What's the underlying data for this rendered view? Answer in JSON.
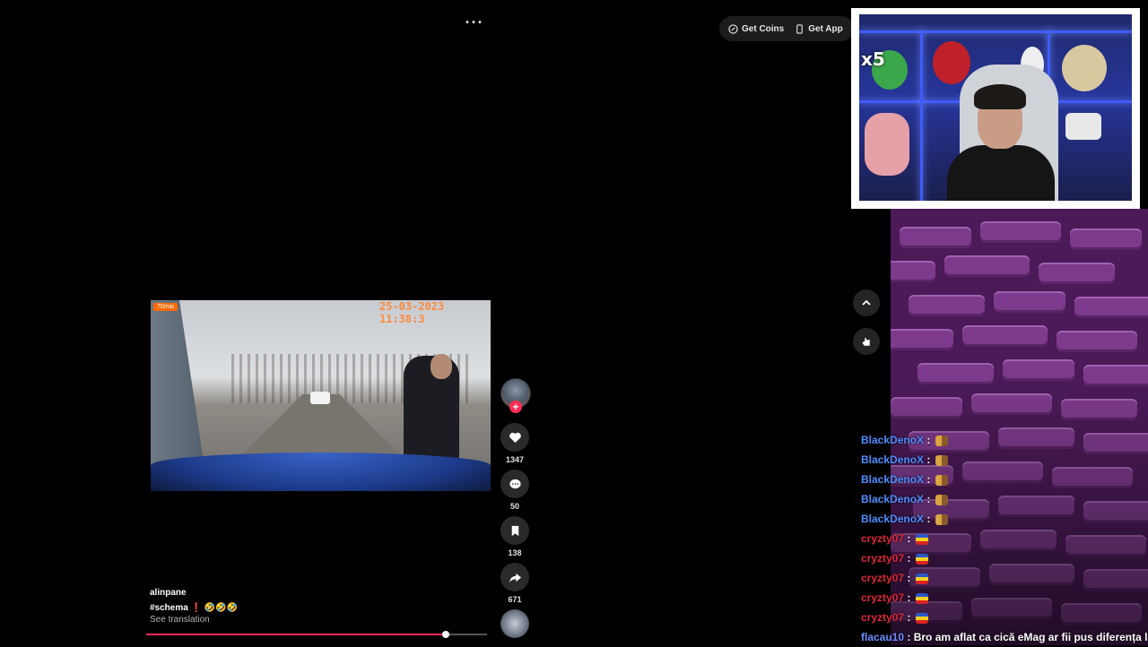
{
  "topbar": {
    "more_label": "···",
    "get_coins": "Get Coins",
    "get_app": "Get App"
  },
  "webcam": {
    "badge": "x5"
  },
  "video": {
    "brand": "70mai",
    "timestamp": "25-03-2023 11:38:3",
    "progress_fraction": 0.88
  },
  "actions": {
    "likes": "1347",
    "comments": "50",
    "saves": "138",
    "shares": "671"
  },
  "post": {
    "username": "alinpane",
    "caption": "#schema ❗ 🤣🤣🤣",
    "see_translation": "See translation"
  },
  "chat": [
    {
      "user": "BlackDenoX",
      "sep": " : ",
      "msg": "",
      "user_color": "#4f8cff",
      "emote": "cat-emote"
    },
    {
      "user": "BlackDenoX",
      "sep": " : ",
      "msg": "",
      "user_color": "#4f8cff",
      "emote": "cat-emote"
    },
    {
      "user": "BlackDenoX",
      "sep": " : ",
      "msg": "",
      "user_color": "#4f8cff",
      "emote": "cat-emote"
    },
    {
      "user": "BlackDenoX",
      "sep": " : ",
      "msg": "",
      "user_color": "#4f8cff",
      "emote": "cat-emote"
    },
    {
      "user": "BlackDenoX",
      "sep": " : ",
      "msg": "",
      "user_color": "#4f8cff",
      "emote": "cat-emote"
    },
    {
      "user": "cryzty07",
      "sep": " : ",
      "msg": "",
      "user_color": "#e0263a",
      "emote": "flag-emote"
    },
    {
      "user": "cryzty07",
      "sep": " : ",
      "msg": "",
      "user_color": "#e0263a",
      "emote": "flag-emote"
    },
    {
      "user": "cryzty07",
      "sep": " : ",
      "msg": "",
      "user_color": "#e0263a",
      "emote": "flag-emote"
    },
    {
      "user": "cryzty07",
      "sep": " : ",
      "msg": "",
      "user_color": "#e0263a",
      "emote": "flag-emote"
    },
    {
      "user": "cryzty07",
      "sep": " : ",
      "msg": "",
      "user_color": "#e0263a",
      "emote": "flag-emote"
    },
    {
      "user": "flacau10",
      "sep": " : ",
      "msg": "Bro am aflat ca cică eMag ar fii pus diferența la",
      "user_color": "#6a8dff",
      "emote": ""
    }
  ]
}
